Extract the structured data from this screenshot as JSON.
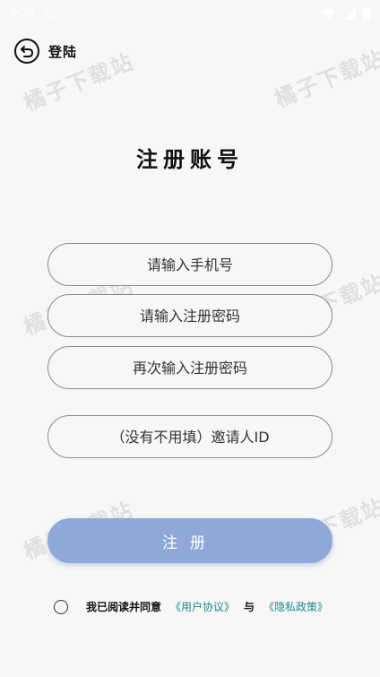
{
  "status_bar": {
    "time": "4:28",
    "icons": [
      "notification-icon",
      "wifi-icon",
      "signal-icon",
      "battery-icon"
    ]
  },
  "topbar": {
    "back_icon": "back-arrow-circle-icon",
    "back_label": "登陆"
  },
  "watermark_text": "橘子下载站",
  "title": "注册账号",
  "form": {
    "phone_placeholder": "请输入手机号",
    "password_placeholder": "请输入注册密码",
    "confirm_placeholder": "再次输入注册密码",
    "invite_placeholder": "（没有不用填）邀请人ID"
  },
  "register_button_label": "注册",
  "agreement": {
    "prefix": "我已阅读并同意",
    "user_agreement": "《用户协议》",
    "conjunction": "与",
    "privacy_policy": "《隐私政策》"
  },
  "colors": {
    "button_bg": "#8fa8d8",
    "link": "#1e8a8a",
    "background": "#f7f7f8"
  }
}
